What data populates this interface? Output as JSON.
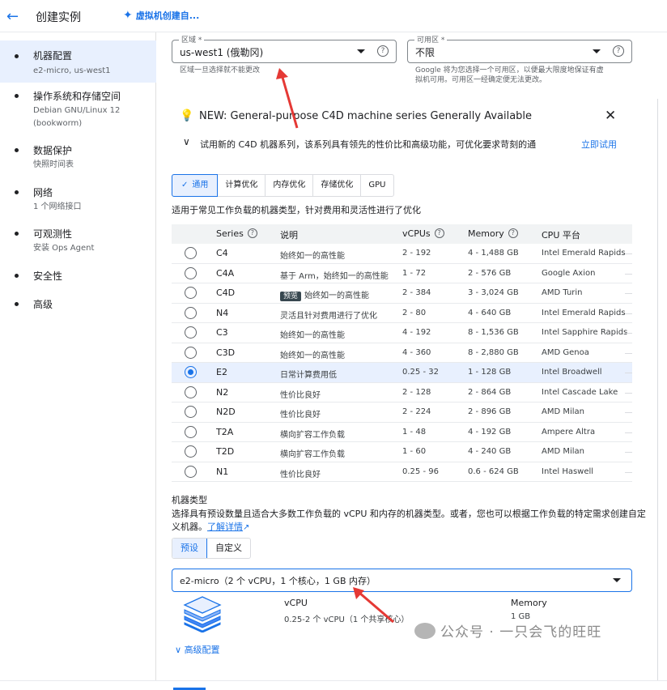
{
  "header": {
    "title": "创建实例",
    "vm_link": "虚拟机创建自..."
  },
  "sidebar": {
    "items": [
      {
        "label": "机器配置",
        "sub": "e2-micro, us-west1",
        "active": true
      },
      {
        "label": "操作系统和存储空间",
        "sub": "Debian GNU/Linux 12 (bookworm)"
      },
      {
        "label": "数据保护",
        "sub": "快照时间表"
      },
      {
        "label": "网络",
        "sub": "1 个网络接口"
      },
      {
        "label": "可观测性",
        "sub": "安装 Ops Agent"
      },
      {
        "label": "安全性",
        "sub": ""
      },
      {
        "label": "高级",
        "sub": ""
      }
    ]
  },
  "region": {
    "label": "区域 *",
    "value": "us-west1 (俄勒冈)",
    "hint": "区域一旦选择就不能更改"
  },
  "zone": {
    "label": "可用区 *",
    "value": "不限",
    "hint_line1": "Google 将为您选择一个可用区，以便最大限度地保证有虚",
    "hint_line2": "拟机可用。可用区一经确定便无法更改。"
  },
  "banner": {
    "title": "NEW: General-purpose C4D machine series Generally Available",
    "desc": "试用新的 C4D 机器系列，该系列具有领先的性价比和高级功能，可优化要求苛刻的通",
    "action": "立即试用"
  },
  "tabs": [
    "通用",
    "计算优化",
    "内存优化",
    "存储优化",
    "GPU"
  ],
  "subtitle": "适用于常见工作负载的机器类型，针对费用和灵活性进行了优化",
  "table": {
    "headers": {
      "series": "Series",
      "desc": "说明",
      "vcpus": "vCPUs",
      "memory": "Memory",
      "cpu": "CPU 平台"
    },
    "rows": [
      {
        "series": "C4",
        "desc": "始终如一的高性能",
        "vcpus": "2 - 192",
        "memory": "4 - 1,488 GB",
        "cpu": "Intel Emerald Rapids"
      },
      {
        "series": "C4A",
        "desc": "基于 Arm，始终如一的高性能",
        "vcpus": "1 - 72",
        "memory": "2 - 576 GB",
        "cpu": "Google Axion"
      },
      {
        "series": "C4D",
        "tag": "预览",
        "desc": "始终如一的高性能",
        "vcpus": "2 - 384",
        "memory": "3 - 3,024 GB",
        "cpu": "AMD Turin"
      },
      {
        "series": "N4",
        "desc": "灵活且针对费用进行了优化",
        "vcpus": "2 - 80",
        "memory": "4 - 640 GB",
        "cpu": "Intel Emerald Rapids"
      },
      {
        "series": "C3",
        "desc": "始终如一的高性能",
        "vcpus": "4 - 192",
        "memory": "8 - 1,536 GB",
        "cpu": "Intel Sapphire Rapids"
      },
      {
        "series": "C3D",
        "desc": "始终如一的高性能",
        "vcpus": "4 - 360",
        "memory": "8 - 2,880 GB",
        "cpu": "AMD Genoa"
      },
      {
        "series": "E2",
        "desc": "日常计算费用低",
        "vcpus": "0.25 - 32",
        "memory": "1 - 128 GB",
        "cpu": "Intel Broadwell",
        "selected": true
      },
      {
        "series": "N2",
        "desc": "性价比良好",
        "vcpus": "2 - 128",
        "memory": "2 - 864 GB",
        "cpu": "Intel Cascade Lake"
      },
      {
        "series": "N2D",
        "desc": "性价比良好",
        "vcpus": "2 - 224",
        "memory": "2 - 896 GB",
        "cpu": "AMD Milan"
      },
      {
        "series": "T2A",
        "desc": "横向扩容工作负载",
        "vcpus": "1 - 48",
        "memory": "4 - 192 GB",
        "cpu": "Ampere Altra"
      },
      {
        "series": "T2D",
        "desc": "横向扩容工作负载",
        "vcpus": "1 - 60",
        "memory": "4 - 240 GB",
        "cpu": "AMD Milan"
      },
      {
        "series": "N1",
        "desc": "性价比良好",
        "vcpus": "0.25 - 96",
        "memory": "0.6 - 624 GB",
        "cpu": "Intel Haswell"
      }
    ]
  },
  "machine_type": {
    "title": "机器类型",
    "desc": "选择具有预设数量且适合大多数工作负载的 vCPU 和内存的机器类型。或者，您也可以根据工作负载的特定需求创建自定义机器。",
    "more": "了解详情",
    "toggle": [
      "预设",
      "自定义"
    ],
    "selected": "e2-micro（2 个 vCPU，1 个核心，1 GB 内存）",
    "vcpu_label": "vCPU",
    "vcpu_value": "0.25-2 个 vCPU（1 个共享核心）",
    "memory_label": "Memory",
    "memory_value": "1 GB",
    "advanced": "高级配置"
  },
  "watermark": "公众号 · 一只会飞的旺旺",
  "colors": {
    "accent": "#1a73e8",
    "annotation_arrow": "#e53935"
  }
}
